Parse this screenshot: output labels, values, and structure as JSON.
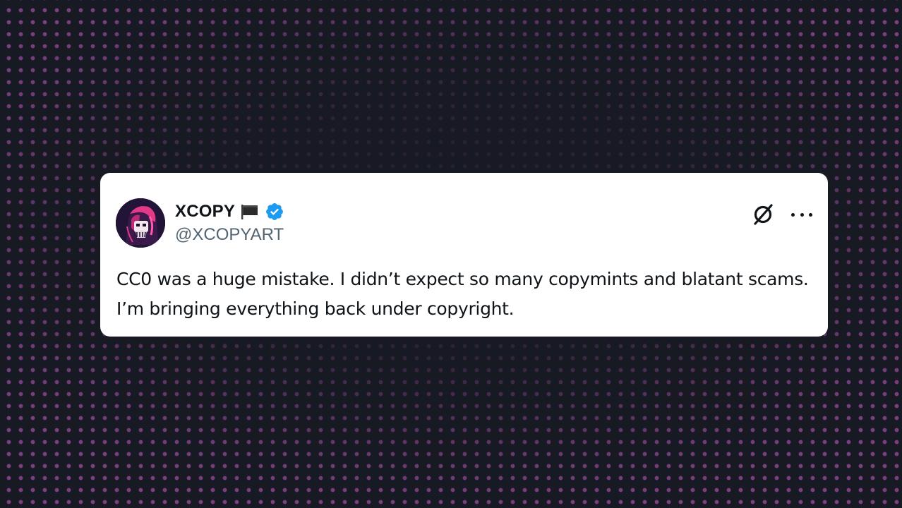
{
  "tweet": {
    "display_name": "XCOPY",
    "handle": "@XCOPYART",
    "text": "CC0 was a huge mistake. I didn’t expect so many copymints and blatant scams. I’m bringing everything back under copyright.",
    "icons": {
      "flag": "black-flag-icon",
      "verified": "verified-badge-icon",
      "brand": "x-logo-icon",
      "more": "more-options-icon"
    }
  },
  "colors": {
    "background": "#171a23",
    "dots": "#7a3f7e",
    "card": "#ffffff",
    "text_primary": "#0f1419",
    "text_secondary": "#536471",
    "verified_blue": "#1d9bf0"
  }
}
